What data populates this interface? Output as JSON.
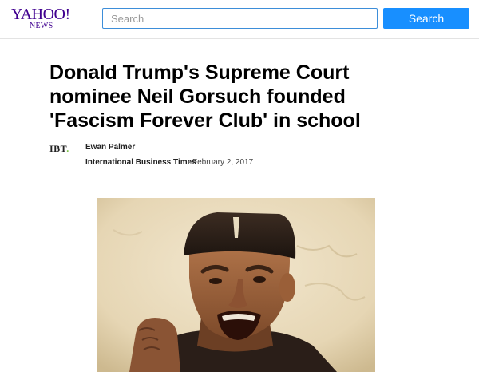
{
  "header": {
    "logo_main": "YAHOO!",
    "logo_sub": "NEWS",
    "search": {
      "placeholder": "Search",
      "value": ""
    },
    "search_button_label": "Search"
  },
  "article": {
    "headline": "Donald Trump's Supreme Court nominee Neil Gorsuch founded 'Fascism Forever Club' in school",
    "publisher_logo": "IBT",
    "publisher_logo_dot": ".",
    "author": "Ewan Palmer",
    "publisher": "International Business Times",
    "date": "February 2, 2017",
    "image": {
      "icon": "portrait-photo-icon"
    }
  },
  "colors": {
    "brand": "#400090",
    "accent": "#188fff",
    "input_border": "#3d8ed9",
    "ibt_dot": "#79c142"
  }
}
